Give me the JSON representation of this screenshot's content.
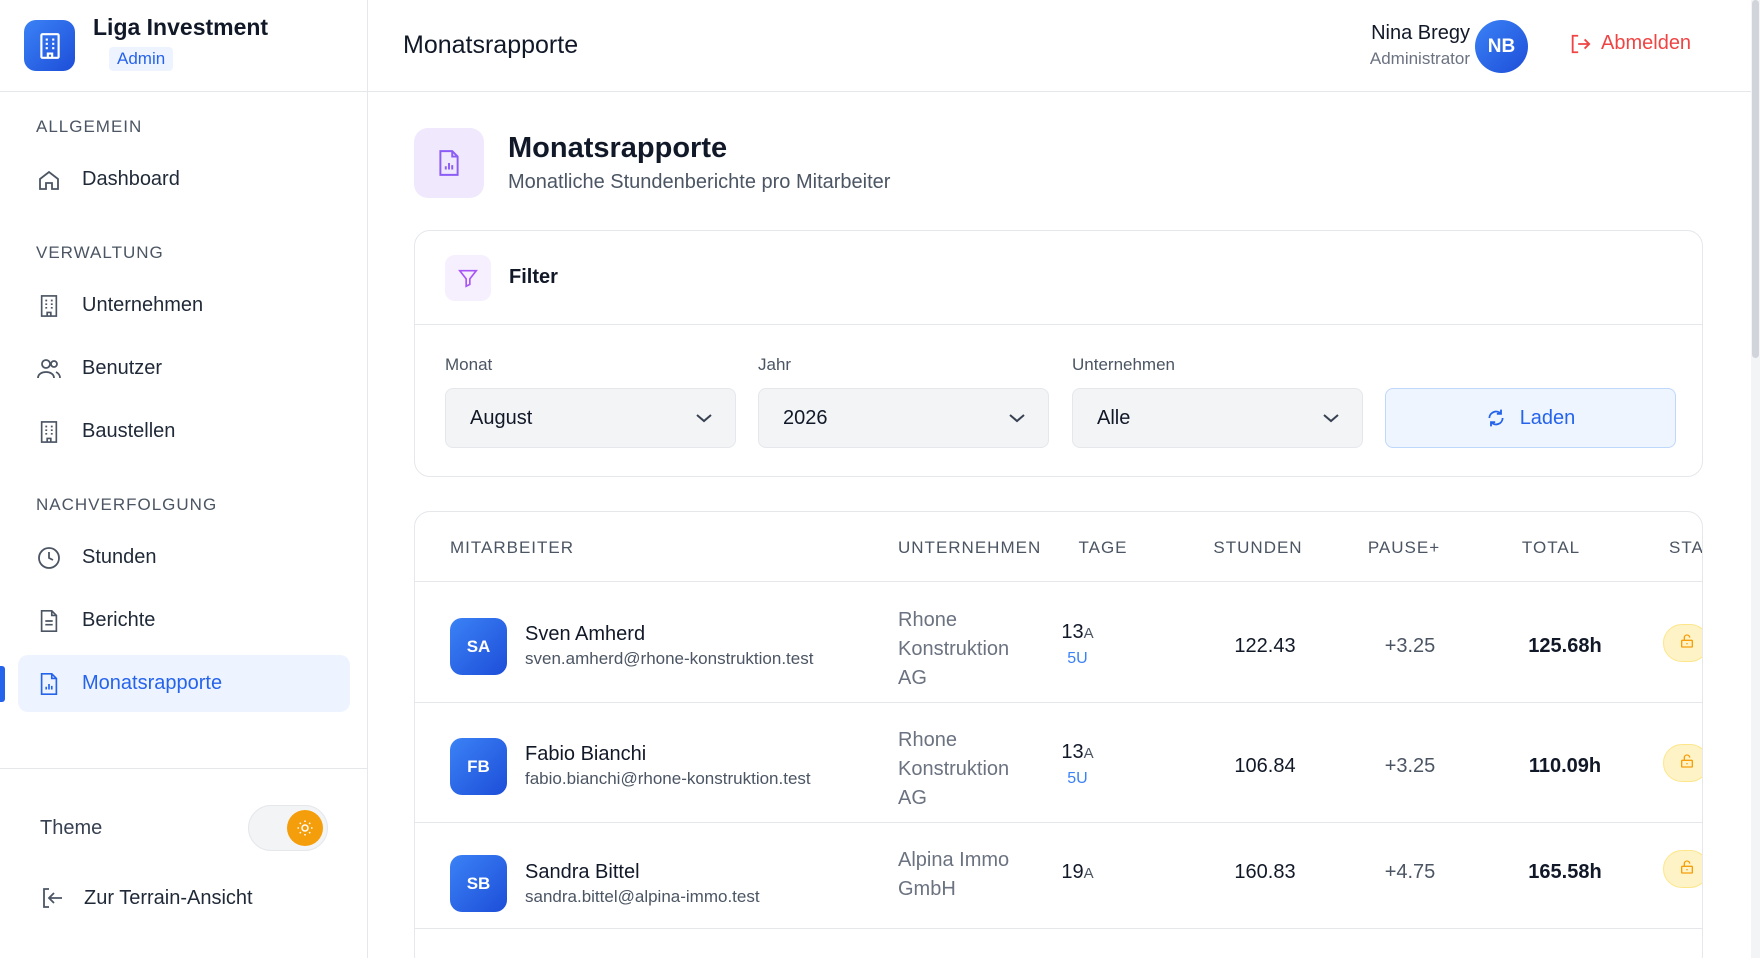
{
  "brand": {
    "name": "Liga Investment",
    "badge": "Admin"
  },
  "sidebar": {
    "sections": [
      {
        "label": "ALLGEMEIN"
      },
      {
        "label": "VERWALTUNG"
      },
      {
        "label": "NACHVERFOLGUNG"
      }
    ],
    "items": [
      {
        "label": "Dashboard",
        "icon": "home-icon"
      },
      {
        "label": "Unternehmen",
        "icon": "building-icon"
      },
      {
        "label": "Benutzer",
        "icon": "users-icon"
      },
      {
        "label": "Baustellen",
        "icon": "building-icon"
      },
      {
        "label": "Stunden",
        "icon": "clock-icon"
      },
      {
        "label": "Berichte",
        "icon": "document-icon"
      },
      {
        "label": "Monatsrapporte",
        "icon": "chart-document-icon",
        "active": true
      }
    ],
    "theme_label": "Theme",
    "terrain_label": "Zur Terrain-Ansicht"
  },
  "header": {
    "title": "Monatsrapporte",
    "user_name": "Nina Bregy",
    "user_role": "Administrator",
    "user_initials": "NB",
    "logout_label": "Abmelden"
  },
  "page": {
    "title": "Monatsrapporte",
    "subtitle": "Monatliche Stundenberichte pro Mitarbeiter"
  },
  "filter": {
    "title": "Filter",
    "month_label": "Monat",
    "month_value": "August",
    "year_label": "Jahr",
    "year_value": "2026",
    "company_label": "Unternehmen",
    "company_value": "Alle",
    "load_label": "Laden"
  },
  "table": {
    "columns": [
      "MITARBEITER",
      "UNTERNEHMEN",
      "TAGE",
      "STUNDEN",
      "PAUSE+",
      "TOTAL",
      "STA"
    ],
    "rows": [
      {
        "initials": "SA",
        "name": "Sven Amherd",
        "email": "sven.amherd@rhone-konstruktion.test",
        "company_lines": [
          "Rhone",
          "Konstruktion",
          "AG"
        ],
        "days": "13",
        "days_suffix": "A",
        "days_u": "5U",
        "hours": "122.43",
        "pause": "+3.25",
        "total": "125.68h"
      },
      {
        "initials": "FB",
        "name": "Fabio Bianchi",
        "email": "fabio.bianchi@rhone-konstruktion.test",
        "company_lines": [
          "Rhone",
          "Konstruktion",
          "AG"
        ],
        "days": "13",
        "days_suffix": "A",
        "days_u": "5U",
        "hours": "106.84",
        "pause": "+3.25",
        "total": "110.09h"
      },
      {
        "initials": "SB",
        "name": "Sandra Bittel",
        "email": "sandra.bittel@alpina-immo.test",
        "company_lines": [
          "Alpina Immo",
          "GmbH"
        ],
        "days": "19",
        "days_suffix": "A",
        "days_u": "",
        "hours": "160.83",
        "pause": "+4.75",
        "total": "165.58h"
      }
    ]
  },
  "colors": {
    "accent": "#2563eb",
    "danger": "#ef4444",
    "purple": "#8b5cf6",
    "amber": "#f59e0b"
  }
}
